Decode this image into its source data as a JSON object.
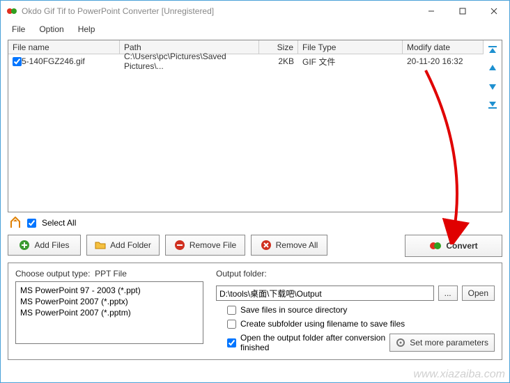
{
  "window": {
    "title": "Okdo Gif Tif to PowerPoint Converter [Unregistered]"
  },
  "menu": {
    "file": "File",
    "option": "Option",
    "help": "Help"
  },
  "columns": {
    "name": "File name",
    "path": "Path",
    "size": "Size",
    "type": "File Type",
    "date": "Modify date"
  },
  "rows": [
    {
      "name": "5-140FGZ246.gif",
      "path": "C:\\Users\\pc\\Pictures\\Saved Pictures\\...",
      "size": "2KB",
      "type": "GIF 文件",
      "date": "20-11-20 16:32",
      "checked": true
    }
  ],
  "selectall": {
    "label": "Select All",
    "checked": true
  },
  "buttons": {
    "addfiles": "Add Files",
    "addfolder": "Add Folder",
    "removefile": "Remove File",
    "removeall": "Remove All",
    "convert": "Convert",
    "browse": "...",
    "open": "Open",
    "setmore": "Set more parameters"
  },
  "output": {
    "typelabel": "Choose output type:",
    "typeval": "PPT File",
    "options": [
      "MS PowerPoint 97 - 2003 (*.ppt)",
      "MS PowerPoint 2007 (*.pptx)",
      "MS PowerPoint 2007 (*.pptm)"
    ],
    "folderlabel": "Output folder:",
    "foldervalue": "D:\\tools\\桌面\\下载吧\\Output",
    "chk_src": "Save files in source directory",
    "chk_sub": "Create subfolder using filename to save files",
    "chk_open": "Open the output folder after conversion finished",
    "chk_src_v": false,
    "chk_sub_v": false,
    "chk_open_v": true
  },
  "watermark": "www.xiazaiba.com"
}
